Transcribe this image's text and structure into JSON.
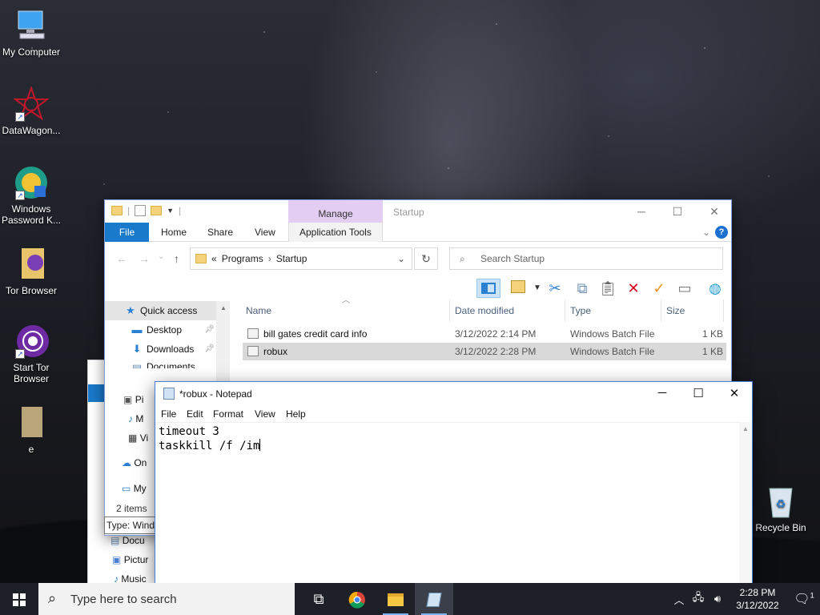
{
  "desktop": {
    "icons": [
      {
        "label": "My Computer"
      },
      {
        "label": "DataWagon..."
      },
      {
        "label": "Windows Password K..."
      },
      {
        "label": "Tor Browser"
      },
      {
        "label": "Start Tor Browser"
      },
      {
        "label": "e"
      },
      {
        "label": "Recycle Bin"
      }
    ]
  },
  "explorer": {
    "title": "Startup",
    "context_tab": "Manage",
    "ribbon_tabs": [
      "File",
      "Home",
      "Share",
      "View",
      "Application Tools"
    ],
    "breadcrumb": {
      "prefix": "«",
      "items": [
        "Programs",
        "Startup"
      ]
    },
    "search_placeholder": "Search Startup",
    "nav_items": [
      {
        "label": "Quick access"
      },
      {
        "label": "Desktop"
      },
      {
        "label": "Downloads"
      },
      {
        "label": "Documents"
      },
      {
        "label": "Pi"
      },
      {
        "label": "M"
      },
      {
        "label": "Vi"
      },
      {
        "label": "On"
      },
      {
        "label": "My"
      }
    ],
    "columns": [
      "Name",
      "Date modified",
      "Type",
      "Size"
    ],
    "files": [
      {
        "name": "bill gates credit card info",
        "date": "3/12/2022 2:14 PM",
        "type": "Windows Batch File",
        "size": "1 KB"
      },
      {
        "name": "robux",
        "date": "3/12/2022 2:28 PM",
        "type": "Windows Batch File",
        "size": "1 KB"
      }
    ],
    "status": "2 items",
    "tooltip": "Type: Windo"
  },
  "bg_explorer": {
    "items": [
      "Docu",
      "Pictur",
      "Music"
    ]
  },
  "notepad": {
    "title": "*robux - Notepad",
    "menu": [
      "File",
      "Edit",
      "Format",
      "View",
      "Help"
    ],
    "lines": [
      "timeout 3",
      "taskkill /f /im"
    ]
  },
  "taskbar": {
    "search_placeholder": "Type here to search",
    "time": "2:28 PM",
    "date": "3/12/2022",
    "notification_count": "1"
  },
  "colors": {
    "accent": "#1979ca",
    "manage_tab": "#e4cdf2",
    "delete_red": "#d0021b",
    "check_orange": "#e8901c"
  }
}
